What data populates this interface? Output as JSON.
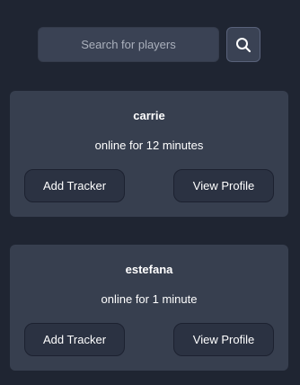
{
  "search": {
    "placeholder": "Search for players",
    "icon": "search-icon"
  },
  "players": [
    {
      "name": "carrie",
      "status": "online for 12 minutes",
      "add_tracker_label": "Add Tracker",
      "view_profile_label": "View Profile"
    },
    {
      "name": "estefana",
      "status": "online for 1 minute",
      "add_tracker_label": "Add Tracker",
      "view_profile_label": "View Profile"
    }
  ],
  "colors": {
    "background": "#1f2532",
    "card": "#373f4f",
    "button": "#2b3242",
    "input": "#3a4254"
  }
}
